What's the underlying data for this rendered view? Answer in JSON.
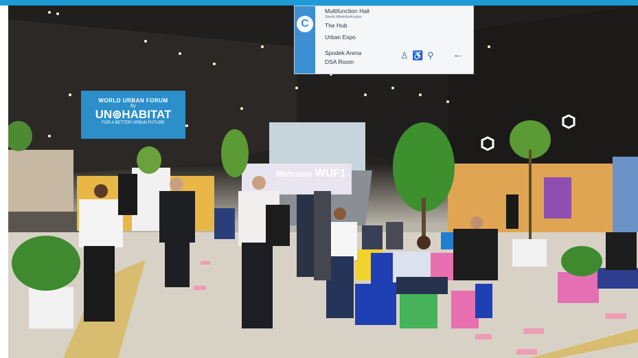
{
  "signage": {
    "hall_sign": {
      "letter": "C",
      "lines": [
        "Multifunction Hall",
        "The Hub",
        "Urban Expo",
        "Spodek Arena",
        "DSA Room"
      ],
      "subline": "Strefa Wielofunkcyjna",
      "icons": [
        "person-icon",
        "accessibility-icon",
        "toilet-icon",
        "left-arrow-icon"
      ],
      "arrow": "←"
    },
    "wuf_banner": {
      "line1": "WORLD URBAN FORUM",
      "line2": "by",
      "line3": "UN⊚HABITAT",
      "line4": "FOR A BETTER URBAN FUTURE"
    },
    "welcome_wall": {
      "text": "Welcome",
      "logo": "WUF1"
    }
  },
  "colors": {
    "top_bar": "#1e9ad6",
    "sign_accent": "#3c8fd3",
    "banner_blue": "#2c8fca",
    "cube_yellow": "#f2d22e",
    "cube_blue": "#1f3fb4",
    "cube_pink": "#e86fb0",
    "cube_green": "#46b35a"
  }
}
